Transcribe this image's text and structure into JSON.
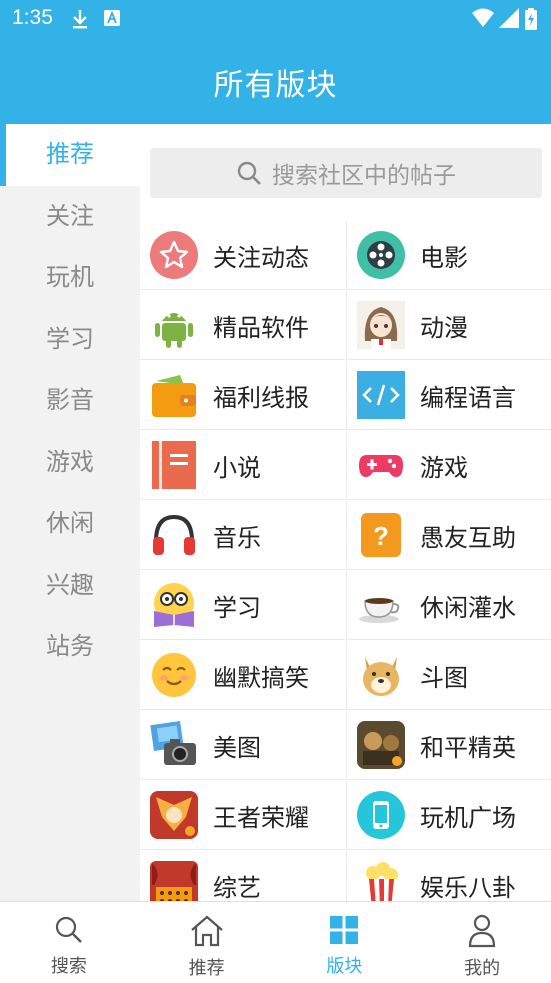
{
  "status_bar": {
    "time": "1:35"
  },
  "header": {
    "title": "所有版块"
  },
  "sidebar": {
    "items": [
      {
        "label": "推荐",
        "active": true
      },
      {
        "label": "关注"
      },
      {
        "label": "玩机"
      },
      {
        "label": "学习"
      },
      {
        "label": "影音"
      },
      {
        "label": "游戏"
      },
      {
        "label": "休闲"
      },
      {
        "label": "兴趣"
      },
      {
        "label": "站务"
      }
    ]
  },
  "search": {
    "placeholder": "搜索社区中的帖子"
  },
  "boards": [
    {
      "label": "关注动态",
      "icon": "star-icon"
    },
    {
      "label": "电影",
      "icon": "film-reel-icon"
    },
    {
      "label": "精品软件",
      "icon": "android-icon"
    },
    {
      "label": "动漫",
      "icon": "anime-girl-icon"
    },
    {
      "label": "福利线报",
      "icon": "wallet-icon"
    },
    {
      "label": "编程语言",
      "icon": "code-icon"
    },
    {
      "label": "小说",
      "icon": "book-icon"
    },
    {
      "label": "游戏",
      "icon": "gamepad-icon"
    },
    {
      "label": "音乐",
      "icon": "headphones-icon"
    },
    {
      "label": "愚友互助",
      "icon": "question-icon"
    },
    {
      "label": "学习",
      "icon": "student-icon"
    },
    {
      "label": "休闲灌水",
      "icon": "coffee-cup-icon"
    },
    {
      "label": "幽默搞笑",
      "icon": "smiley-icon"
    },
    {
      "label": "斗图",
      "icon": "doge-icon"
    },
    {
      "label": "美图",
      "icon": "photo-camera-icon"
    },
    {
      "label": "和平精英",
      "icon": "pubg-icon"
    },
    {
      "label": "王者荣耀",
      "icon": "honor-of-kings-icon"
    },
    {
      "label": "玩机广场",
      "icon": "phone-icon"
    },
    {
      "label": "综艺",
      "icon": "stage-icon"
    },
    {
      "label": "娱乐八卦",
      "icon": "popcorn-icon"
    }
  ],
  "bottom_nav": [
    {
      "label": "搜索",
      "icon": "search-icon"
    },
    {
      "label": "推荐",
      "icon": "home-icon"
    },
    {
      "label": "版块",
      "icon": "grid-icon",
      "active": true
    },
    {
      "label": "我的",
      "icon": "person-icon"
    }
  ],
  "colors": {
    "accent": "#33B2E8",
    "sidebar_bg": "#F2F2F2",
    "search_bg": "#EDEDED"
  }
}
